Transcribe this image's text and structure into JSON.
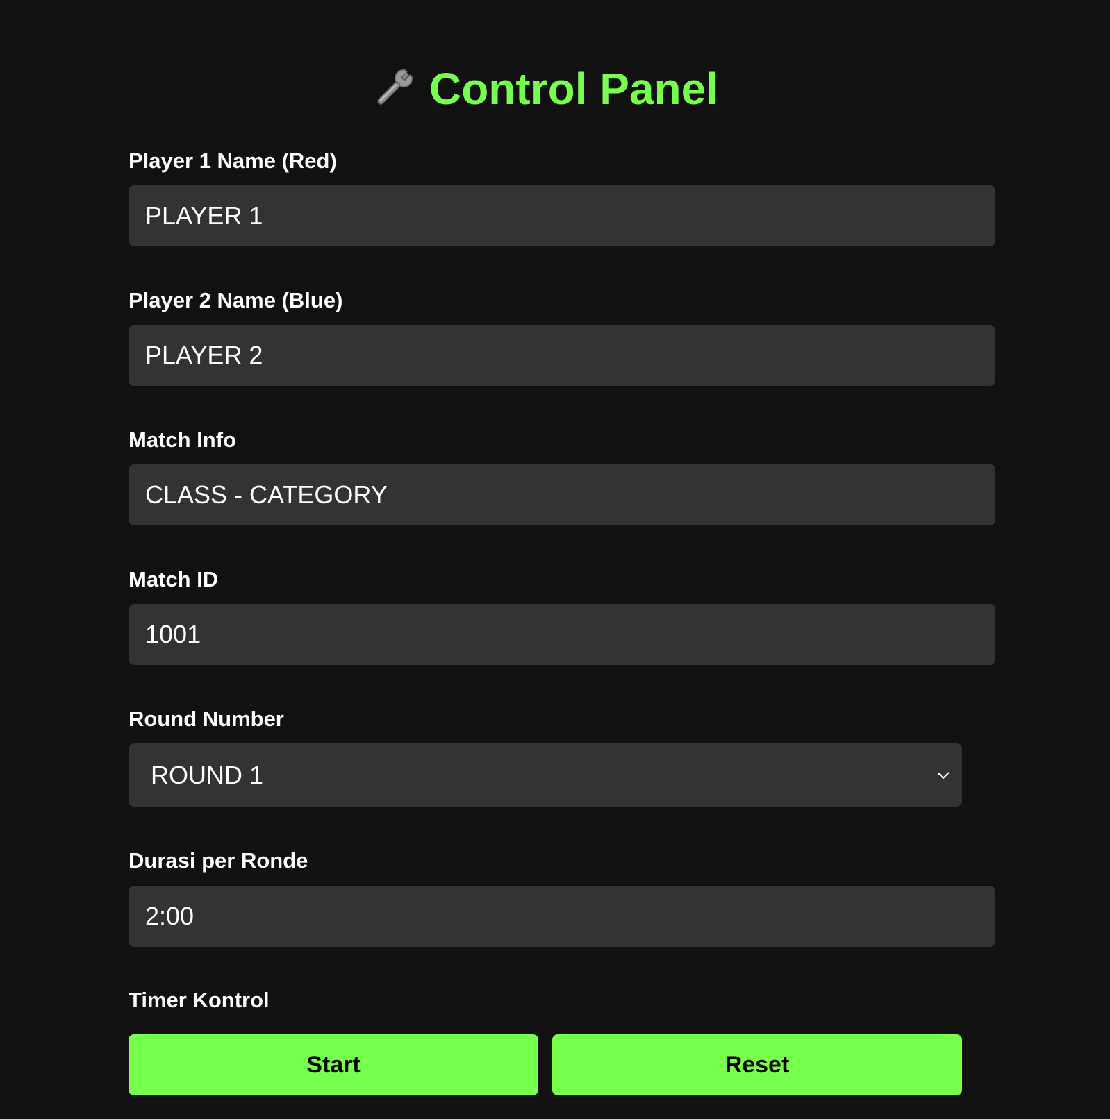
{
  "theme": {
    "accent": "#77ff4d",
    "background": "#111111",
    "input_bg": "#333333"
  },
  "header": {
    "icon": "wrench-icon",
    "title": "Control Panel"
  },
  "form": {
    "player1": {
      "label": "Player 1 Name (Red)",
      "value": "PLAYER 1"
    },
    "player2": {
      "label": "Player 2 Name (Blue)",
      "value": "PLAYER 2"
    },
    "match_info": {
      "label": "Match Info",
      "value": "CLASS - CATEGORY"
    },
    "match_id": {
      "label": "Match ID",
      "value": "1001"
    },
    "round": {
      "label": "Round Number",
      "selected": "ROUND 1"
    },
    "duration": {
      "label": "Durasi per Ronde",
      "value": "2:00"
    }
  },
  "timer": {
    "label": "Timer Kontrol",
    "start_label": "Start",
    "reset_label": "Reset"
  }
}
